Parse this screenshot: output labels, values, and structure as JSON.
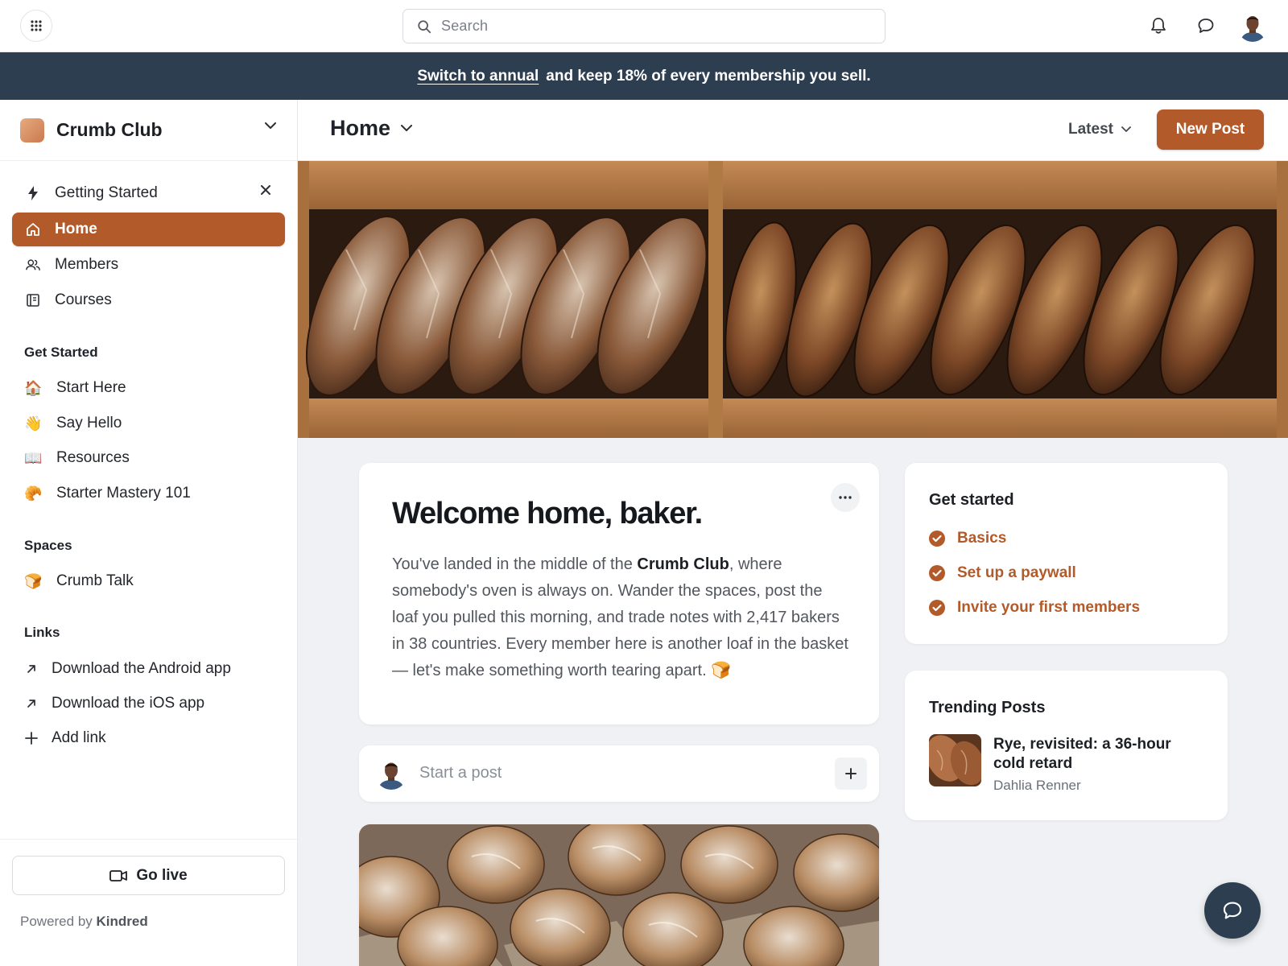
{
  "topbar": {
    "search_placeholder": "Search",
    "apps_icon": "grid-icon",
    "notifications_icon": "bell-icon",
    "messages_icon": "chat-icon"
  },
  "banner": {
    "link_text": "Switch to annual",
    "message": "and keep 18% of every membership you sell."
  },
  "community": {
    "name": "Crumb Club"
  },
  "sidebar": {
    "nav": [
      {
        "label": "Getting Started",
        "icon": "lightning-icon"
      },
      {
        "label": "Home",
        "icon": "home-icon",
        "active": true
      },
      {
        "label": "Members",
        "icon": "users-icon"
      },
      {
        "label": "Courses",
        "icon": "book-icon"
      }
    ],
    "sections": [
      {
        "heading": "Get Started",
        "items": [
          {
            "label": "Start Here",
            "emoji": "🏠"
          },
          {
            "label": "Say Hello",
            "emoji": "👋"
          },
          {
            "label": "Resources",
            "emoji": "📖"
          },
          {
            "label": "Starter Mastery 101",
            "emoji": "🥐"
          }
        ]
      },
      {
        "heading": "Spaces",
        "items": [
          {
            "label": "Crumb Talk",
            "emoji": "🍞"
          }
        ]
      }
    ],
    "links_heading": "Links",
    "links": [
      {
        "label": "Download the Android app",
        "icon": "arrow-up-right-icon"
      },
      {
        "label": "Download the iOS app",
        "icon": "arrow-up-right-icon"
      },
      {
        "label": "Add link",
        "icon": "plus-icon"
      }
    ],
    "go_live_label": "Go live",
    "powered_by_prefix": "Powered by",
    "powered_by_brand": "Kindred"
  },
  "main": {
    "title": "Home",
    "sort_label": "Latest",
    "new_post_label": "New Post"
  },
  "welcome": {
    "heading": "Welcome home, baker.",
    "body_before": "You've landed in the middle of the ",
    "body_bold": "Crumb Club",
    "body_after": ", where somebody's oven is always on. Wander the spaces, post the loaf you pulled this morning, and trade notes with 2,417 bakers in 38 countries. Every member here is another loaf in the basket — let's make something worth tearing apart. 🍞"
  },
  "composer": {
    "placeholder": "Start a post"
  },
  "get_started": {
    "heading": "Get started",
    "items": [
      "Basics",
      "Set up a paywall",
      "Invite your first members"
    ]
  },
  "trending": {
    "heading": "Trending Posts",
    "post_title": "Rye, revisited: a 36-hour cold retard",
    "post_author": "Dahlia Renner"
  },
  "colors": {
    "accent": "#b35a2a",
    "banner": "#2c3e50"
  }
}
